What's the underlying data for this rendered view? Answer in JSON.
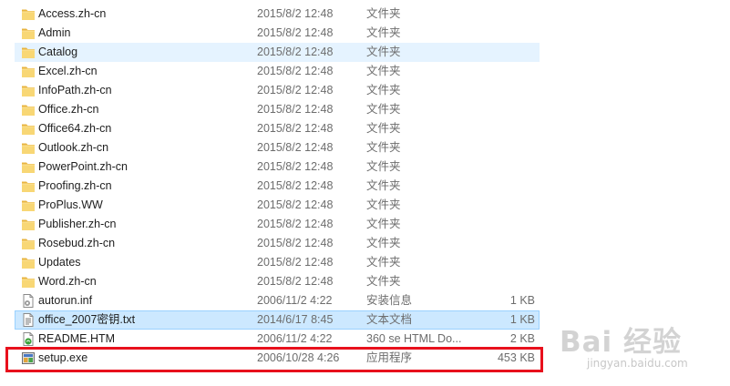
{
  "files": [
    {
      "name": "Access.zh-cn",
      "date": "2015/8/2 12:48",
      "type": "文件夹",
      "size": "",
      "icon": "folder-icon",
      "state": ""
    },
    {
      "name": "Admin",
      "date": "2015/8/2 12:48",
      "type": "文件夹",
      "size": "",
      "icon": "folder-icon",
      "state": ""
    },
    {
      "name": "Catalog",
      "date": "2015/8/2 12:48",
      "type": "文件夹",
      "size": "",
      "icon": "folder-icon",
      "state": "hover"
    },
    {
      "name": "Excel.zh-cn",
      "date": "2015/8/2 12:48",
      "type": "文件夹",
      "size": "",
      "icon": "folder-icon",
      "state": ""
    },
    {
      "name": "InfoPath.zh-cn",
      "date": "2015/8/2 12:48",
      "type": "文件夹",
      "size": "",
      "icon": "folder-icon",
      "state": ""
    },
    {
      "name": "Office.zh-cn",
      "date": "2015/8/2 12:48",
      "type": "文件夹",
      "size": "",
      "icon": "folder-icon",
      "state": ""
    },
    {
      "name": "Office64.zh-cn",
      "date": "2015/8/2 12:48",
      "type": "文件夹",
      "size": "",
      "icon": "folder-icon",
      "state": ""
    },
    {
      "name": "Outlook.zh-cn",
      "date": "2015/8/2 12:48",
      "type": "文件夹",
      "size": "",
      "icon": "folder-icon",
      "state": ""
    },
    {
      "name": "PowerPoint.zh-cn",
      "date": "2015/8/2 12:48",
      "type": "文件夹",
      "size": "",
      "icon": "folder-icon",
      "state": ""
    },
    {
      "name": "Proofing.zh-cn",
      "date": "2015/8/2 12:48",
      "type": "文件夹",
      "size": "",
      "icon": "folder-icon",
      "state": ""
    },
    {
      "name": "ProPlus.WW",
      "date": "2015/8/2 12:48",
      "type": "文件夹",
      "size": "",
      "icon": "folder-icon",
      "state": ""
    },
    {
      "name": "Publisher.zh-cn",
      "date": "2015/8/2 12:48",
      "type": "文件夹",
      "size": "",
      "icon": "folder-icon",
      "state": ""
    },
    {
      "name": "Rosebud.zh-cn",
      "date": "2015/8/2 12:48",
      "type": "文件夹",
      "size": "",
      "icon": "folder-icon",
      "state": ""
    },
    {
      "name": "Updates",
      "date": "2015/8/2 12:48",
      "type": "文件夹",
      "size": "",
      "icon": "folder-icon",
      "state": ""
    },
    {
      "name": "Word.zh-cn",
      "date": "2015/8/2 12:48",
      "type": "文件夹",
      "size": "",
      "icon": "folder-icon",
      "state": ""
    },
    {
      "name": "autorun.inf",
      "date": "2006/11/2 4:22",
      "type": "安装信息",
      "size": "1 KB",
      "icon": "settings-file-icon",
      "state": ""
    },
    {
      "name": "office_2007密钥.txt",
      "date": "2014/6/17 8:45",
      "type": "文本文档",
      "size": "1 KB",
      "icon": "text-file-icon",
      "state": "selected"
    },
    {
      "name": "README.HTM",
      "date": "2006/11/2 4:22",
      "type": "360 se HTML Do...",
      "size": "2 KB",
      "icon": "html-file-icon",
      "state": ""
    },
    {
      "name": "setup.exe",
      "date": "2006/10/28 4:26",
      "type": "应用程序",
      "size": "453 KB",
      "icon": "setup-exe-icon",
      "state": "highlighted"
    }
  ],
  "watermark": {
    "main": "Bai 经验",
    "sub": "jingyan.baidu.com"
  },
  "colors": {
    "folder": "#f8d775",
    "highlight_box": "#e8101c",
    "selected_bg": "#cce8ff",
    "hover_bg": "#e5f3ff"
  }
}
